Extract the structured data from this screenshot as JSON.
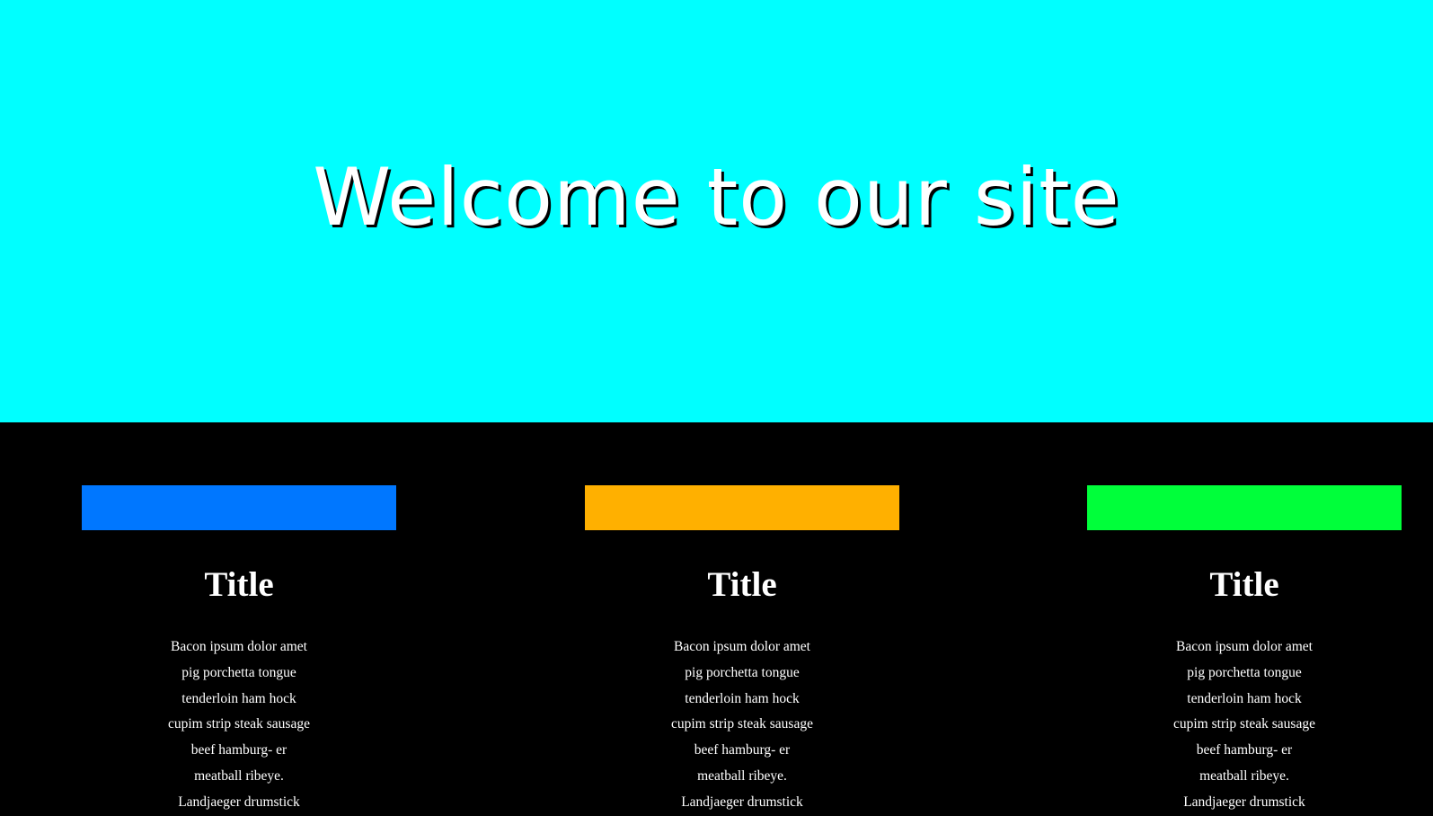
{
  "hero": {
    "title": "Welcome to our site",
    "background": "#00ffff"
  },
  "cards": [
    {
      "accent_color": "#0077ff",
      "title": "Title",
      "text": "Bacon ipsum dolor amet pig porchetta tongue tenderloin ham hock cupim strip steak sausage beef hamburg- er meatball ribeye. Landjaeger drumstick"
    },
    {
      "accent_color": "#ffb000",
      "title": "Title",
      "text": "Bacon ipsum dolor amet pig porchetta tongue tenderloin ham hock cupim strip steak sausage beef hamburg- er meatball ribeye. Landjaeger drumstick"
    },
    {
      "accent_color": "#00ff3a",
      "title": "Title",
      "text": "Bacon ipsum dolor amet pig porchetta tongue tenderloin ham hock cupim strip steak sausage beef hamburg- er meatball ribeye. Landjaeger drumstick"
    }
  ]
}
